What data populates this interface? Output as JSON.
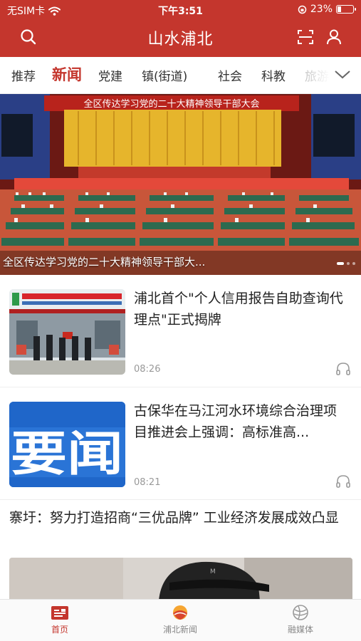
{
  "status_bar": {
    "carrier": "无SIM卡",
    "time": "下午3:51",
    "battery_percent": "23%",
    "battery_level": 0.23
  },
  "nav": {
    "title": "山水浦北"
  },
  "tabs": [
    {
      "label": "推荐"
    },
    {
      "label": "新闻"
    },
    {
      "label": "党建"
    },
    {
      "label": "镇(街道)"
    },
    {
      "label": "社会"
    },
    {
      "label": "科教"
    },
    {
      "label": "旅游"
    }
  ],
  "banner": {
    "caption": "全区传达学习党的二十大精神领导干部大...",
    "stage_banner_text": "全区传达学习党的二十大精神领导干部大会",
    "slide_count": 3,
    "active_slide": 0
  },
  "news": [
    {
      "title": "浦北首个\"个人信用报告自助查询代理点\"正式揭牌",
      "time": "08:26"
    },
    {
      "title": "古保华在马江河水环境综合治理项目推进会上强调：高标准高...",
      "time": "08:21",
      "thumb_text": "要闻"
    }
  ],
  "featured": {
    "title": "寨圩：努力打造招商“三优品牌” 工业经济发展成效凸显"
  },
  "bottom_tabs": [
    {
      "label": "首页",
      "active": true
    },
    {
      "label": "浦北新闻",
      "active": false
    },
    {
      "label": "融媒体",
      "active": false
    }
  ],
  "colors": {
    "brand": "#c4362d",
    "thumb_blue": "#1f66c9"
  }
}
